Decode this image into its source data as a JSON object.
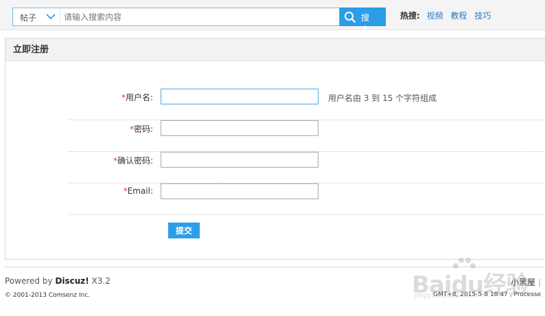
{
  "header": {
    "search_type": "帖子",
    "search_placeholder": "请输入搜索内容",
    "search_button": "搜 索",
    "hot_title": "热搜:",
    "hot_links": [
      "视频",
      "教程",
      "技巧"
    ]
  },
  "panel": {
    "title": "立即注册"
  },
  "form": {
    "required_mark": "*",
    "fields": [
      {
        "label": "用户名:",
        "hint": "用户名由 3 到 15 个字符组成"
      },
      {
        "label": "密码:"
      },
      {
        "label": "确认密码:"
      },
      {
        "label": "Email:"
      }
    ],
    "submit_label": "提交"
  },
  "footer": {
    "powered_prefix": "Powered by ",
    "powered_brand": "Discuz!",
    "powered_version": " X3.2",
    "copyright": "© 2001-2013 Comsenz Inc.",
    "site_name": "小黑屋",
    "separator": "|",
    "server_time": "GMT+8, 2015-5-8 18:47 , Processe"
  },
  "watermark": {
    "text": "Baidu经验",
    "sub": "jingyan.baidu.com"
  },
  "colors": {
    "accent": "#2b9ee8",
    "link": "#2b7ac1",
    "required": "#e4393c"
  },
  "icons": {
    "dropdown": "chevron-down-icon",
    "search": "search-icon"
  }
}
